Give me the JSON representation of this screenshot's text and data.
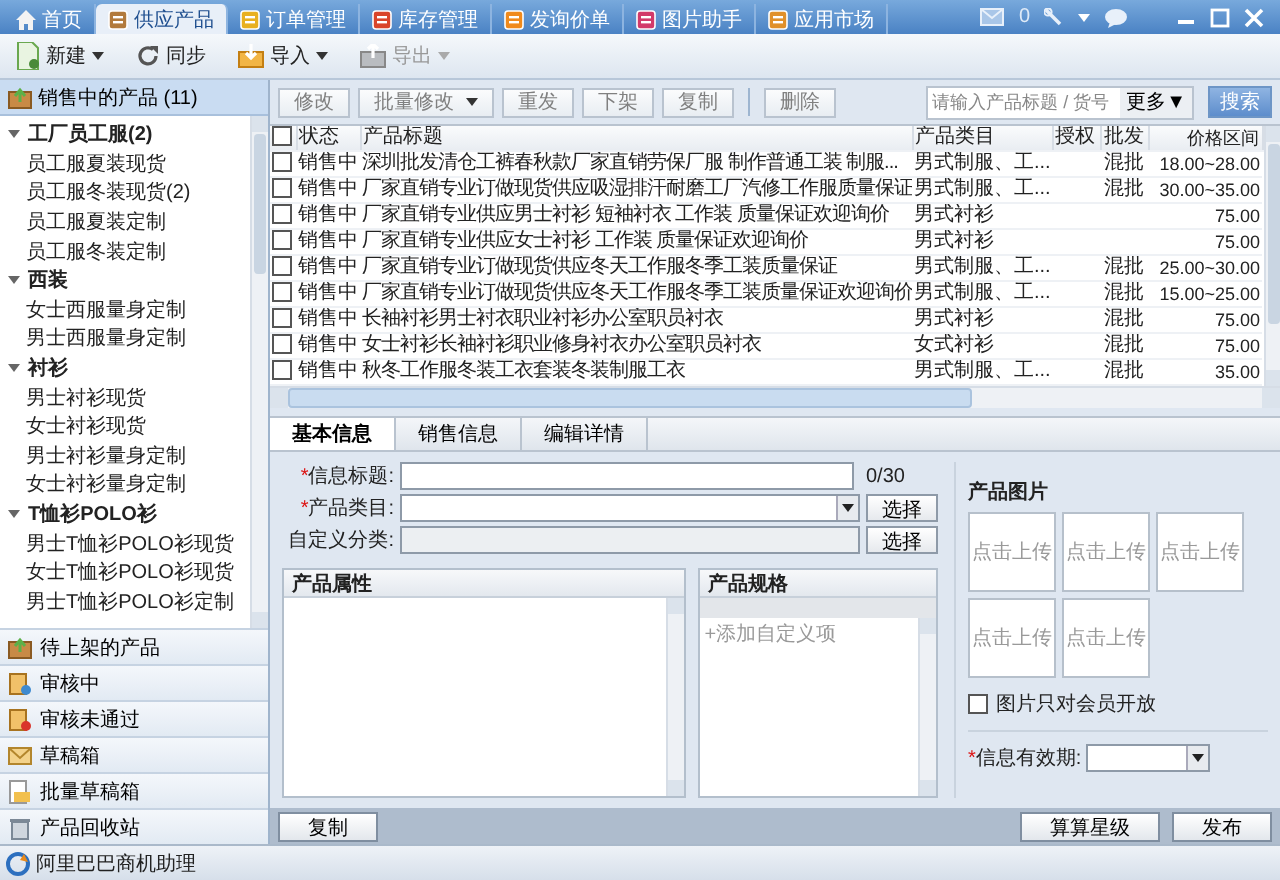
{
  "top_tabs": [
    {
      "label": "首页",
      "selected": false
    },
    {
      "label": "供应产品",
      "selected": true
    },
    {
      "label": "订单管理",
      "selected": false
    },
    {
      "label": "库存管理",
      "selected": false
    },
    {
      "label": "发询价单",
      "selected": false
    },
    {
      "label": "图片助手",
      "selected": false
    },
    {
      "label": "应用市场",
      "selected": false
    }
  ],
  "top_right": {
    "mail_count": "0"
  },
  "toolbar": [
    {
      "label": "新建",
      "dropdown": true,
      "disabled": false
    },
    {
      "label": "同步",
      "dropdown": false,
      "disabled": false
    },
    {
      "label": "导入",
      "dropdown": true,
      "disabled": false
    },
    {
      "label": "导出",
      "dropdown": true,
      "disabled": true
    }
  ],
  "sidebar": {
    "header": {
      "label": "销售中的产品 (11)",
      "selected": true
    },
    "tree": [
      {
        "label": "工厂员工服(2)",
        "expanded": true,
        "children": [
          {
            "label": "员工服夏装现货"
          },
          {
            "label": "员工服冬装现货(2)"
          },
          {
            "label": "员工服夏装定制"
          },
          {
            "label": "员工服冬装定制"
          }
        ]
      },
      {
        "label": "西装",
        "expanded": true,
        "children": [
          {
            "label": "女士西服量身定制"
          },
          {
            "label": "男士西服量身定制"
          }
        ]
      },
      {
        "label": "衬衫",
        "expanded": true,
        "children": [
          {
            "label": "男士衬衫现货"
          },
          {
            "label": "女士衬衫现货"
          },
          {
            "label": "男士衬衫量身定制"
          },
          {
            "label": "女士衬衫量身定制"
          }
        ]
      },
      {
        "label": "T恤衫POLO衫",
        "expanded": true,
        "children": [
          {
            "label": "男士T恤衫POLO衫现货"
          },
          {
            "label": "女士T恤衫POLO衫现货"
          },
          {
            "label": "男士T恤衫POLO衫定制"
          }
        ]
      }
    ],
    "sections": [
      {
        "label": "待上架的产品"
      },
      {
        "label": "审核中"
      },
      {
        "label": "审核未通过"
      },
      {
        "label": "草稿箱"
      },
      {
        "label": "批量草稿箱"
      },
      {
        "label": "产品回收站"
      }
    ]
  },
  "actions": [
    {
      "label": "修改",
      "dropdown": false,
      "disabled": true
    },
    {
      "label": "批量修改",
      "dropdown": true,
      "disabled": true
    },
    {
      "label": "重发",
      "dropdown": false,
      "disabled": true
    },
    {
      "label": "下架",
      "dropdown": false,
      "disabled": true
    },
    {
      "label": "复制",
      "dropdown": false,
      "disabled": true
    },
    {
      "label": "删除",
      "dropdown": false,
      "disabled": true
    }
  ],
  "search": {
    "placeholder": "请输入产品标题 / 货号",
    "more": "更多▼",
    "button": "搜索"
  },
  "table": {
    "select_all_checked": false,
    "columns": [
      "状态",
      "产品标题",
      "产品类目",
      "授权",
      "批发",
      "价格区间"
    ],
    "rows": [
      {
        "checked": false,
        "cells": [
          "销售中",
          "深圳批发清仓工裤春秋款厂家直销劳保厂服 制作普通工装 制服...",
          "男式制服、工...",
          "",
          "混批",
          "18.00~28.00"
        ]
      },
      {
        "checked": false,
        "cells": [
          "销售中",
          "厂家直销专业订做现货供应吸湿排汗耐磨工厂汽修工作服质量保证",
          "男式制服、工...",
          "",
          "混批",
          "30.00~35.00"
        ]
      },
      {
        "checked": false,
        "cells": [
          "销售中",
          "厂家直销专业供应男士衬衫 短袖衬衣 工作装 质量保证欢迎询价",
          "男式衬衫",
          "",
          "",
          "75.00"
        ]
      },
      {
        "checked": false,
        "cells": [
          "销售中",
          "厂家直销专业供应女士衬衫 工作装 质量保证欢迎询价",
          "男式衬衫",
          "",
          "",
          "75.00"
        ]
      },
      {
        "checked": false,
        "cells": [
          "销售中",
          "厂家直销专业订做现货供应冬天工作服冬季工装质量保证",
          "男式制服、工...",
          "",
          "混批",
          "25.00~30.00"
        ]
      },
      {
        "checked": false,
        "cells": [
          "销售中",
          "厂家直销专业订做现货供应冬天工作服冬季工装质量保证欢迎询价",
          "男式制服、工...",
          "",
          "混批",
          "15.00~25.00"
        ]
      },
      {
        "checked": false,
        "cells": [
          "销售中",
          "长袖衬衫男士衬衣职业衬衫办公室职员衬衣",
          "男式衬衫",
          "",
          "混批",
          "75.00"
        ]
      },
      {
        "checked": false,
        "cells": [
          "销售中",
          "女士衬衫长袖衬衫职业修身衬衣办公室职员衬衣",
          "女式衬衫",
          "",
          "混批",
          "75.00"
        ]
      },
      {
        "checked": false,
        "cells": [
          "销售中",
          "秋冬工作服冬装工衣套装冬装制服工衣",
          "男式制服、工...",
          "",
          "混批",
          "35.00"
        ]
      }
    ]
  },
  "detail_tabs": [
    {
      "label": "基本信息",
      "selected": true
    },
    {
      "label": "销售信息",
      "selected": false
    },
    {
      "label": "编辑详情",
      "selected": false
    }
  ],
  "form": {
    "fields": [
      {
        "kind": "text",
        "required_mark": "*",
        "label": "信息标题:",
        "counter": "0/30"
      },
      {
        "kind": "select",
        "required_mark": "*",
        "label": "产品类目:",
        "button": "选择"
      },
      {
        "kind": "readonly",
        "label": "自定义分类:",
        "button": "选择"
      }
    ],
    "attributes_panel": {
      "title": "产品属性"
    },
    "spec_panel": {
      "title": "产品规格",
      "add_link": "+添加自定义项"
    },
    "images": {
      "title": "产品图片",
      "slots": [
        "点击上传",
        "点击上传",
        "点击上传",
        "点击上传",
        "点击上传"
      ],
      "members_only": {
        "label": "图片只对会员开放",
        "checked": false
      }
    },
    "validity": {
      "required_mark": "*",
      "label": "信息有效期:"
    }
  },
  "bottom_buttons": {
    "left": [
      "复制"
    ],
    "right": [
      "算算星级",
      "发布"
    ]
  },
  "status_bar": {
    "label": "阿里巴巴商机助理"
  }
}
